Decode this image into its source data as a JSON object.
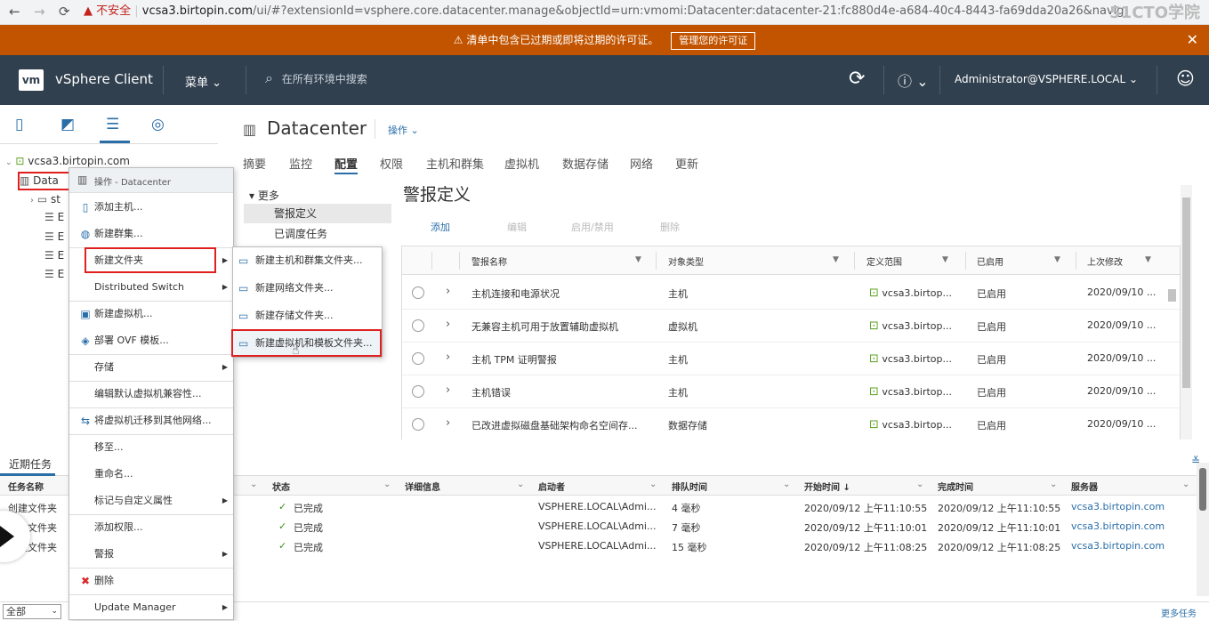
{
  "browser": {
    "back": "←",
    "forward": "→",
    "reload": "⟳",
    "insecure": "▲ 不安全",
    "url_host": "vcsa3.birtopin.com",
    "url_path": "/ui/#?extensionId=vsphere.core.datacenter.manage&objectId=urn:vmomi:Datacenter:datacenter-21:fc880d4e-a684-40c4-8443-fa69dda20a26&navigator=vsph",
    "watermark": "51CTO学院"
  },
  "banner": {
    "message": "⚠ 清单中包含已过期或即将过期的许可证。",
    "button": "管理您的许可证",
    "close": "✕"
  },
  "header": {
    "logo": "vm",
    "title": "vSphere Client",
    "menu": "菜单 ⌄",
    "search_placeholder": "在所有环境中搜索",
    "search_icon": "⌕",
    "refresh": "⟳",
    "help": "ⓘ ⌄",
    "user": "Administrator@VSPHERE.LOCAL ⌄",
    "smiley": "☺"
  },
  "nav": {
    "tree": {
      "root": "vcsa3.birtopin.com",
      "datacenter": "Data",
      "folder": "st",
      "hosts": [
        "E",
        "E",
        "E",
        "E"
      ]
    }
  },
  "main": {
    "title": "Datacenter",
    "actions": "操作 ⌄",
    "tabs": [
      "摘要",
      "监控",
      "配置",
      "权限",
      "主机和群集",
      "虚拟机",
      "数据存储",
      "网络",
      "更新"
    ],
    "sub_more": "▾ 更多",
    "sub_alarm": "警报定义",
    "sub_tasks": "已调度任务",
    "section_title": "警报定义",
    "toolbar": {
      "add": "添加",
      "edit": "编辑",
      "toggle": "启用/禁用",
      "delete": "删除"
    },
    "grid": {
      "columns": [
        "警报名称",
        "对象类型",
        "定义范围",
        "已启用",
        "上次修改"
      ],
      "rows": [
        {
          "name": "主机连接和电源状况",
          "type": "主机",
          "scope": "vcsa3.birtop...",
          "enabled": "已启用",
          "modified": "2020/09/10 ..."
        },
        {
          "name": "无兼容主机可用于放置辅助虚拟机",
          "type": "虚拟机",
          "scope": "vcsa3.birtop...",
          "enabled": "已启用",
          "modified": "2020/09/10 ..."
        },
        {
          "name": "主机 TPM 证明警报",
          "type": "主机",
          "scope": "vcsa3.birtop...",
          "enabled": "已启用",
          "modified": "2020/09/10 ..."
        },
        {
          "name": "主机错误",
          "type": "主机",
          "scope": "vcsa3.birtop...",
          "enabled": "已启用",
          "modified": "2020/09/10 ..."
        },
        {
          "name": "已改进虚拟磁盘基础架构命名空间存...",
          "type": "数据存储",
          "scope": "vcsa3.birtop...",
          "enabled": "已启用",
          "modified": "2020/09/10 ..."
        }
      ]
    }
  },
  "context_menu": {
    "header": "操作 - Datacenter",
    "items": [
      {
        "label": "添加主机...",
        "icon": "add-host-icon",
        "glyph": "▯"
      },
      {
        "label": "新建群集...",
        "icon": "cluster-icon",
        "glyph": "◍"
      },
      {
        "label": "新建文件夹",
        "icon": "",
        "glyph": "",
        "arrow": "▶"
      },
      {
        "label": "Distributed Switch",
        "icon": "",
        "glyph": "",
        "arrow": "▶"
      },
      {
        "label": "新建虚拟机...",
        "icon": "new-vm-icon",
        "glyph": "▣"
      },
      {
        "label": "部署 OVF 模板...",
        "icon": "ovf-icon",
        "glyph": "◈"
      },
      {
        "label": "存储",
        "icon": "",
        "glyph": "",
        "arrow": "▶"
      },
      {
        "label": "编辑默认虚拟机兼容性...",
        "icon": "",
        "glyph": ""
      },
      {
        "label": "将虚拟机迁移到其他网络...",
        "icon": "migrate-icon",
        "glyph": "⇆"
      },
      {
        "label": "移至...",
        "icon": "",
        "glyph": ""
      },
      {
        "label": "重命名...",
        "icon": "",
        "glyph": ""
      },
      {
        "label": "标记与自定义属性",
        "icon": "",
        "glyph": "",
        "arrow": "▶"
      },
      {
        "label": "添加权限...",
        "icon": "",
        "glyph": ""
      },
      {
        "label": "警报",
        "icon": "",
        "glyph": "",
        "arrow": "▶"
      },
      {
        "label": "删除",
        "icon": "delete-icon",
        "glyph": "✖"
      },
      {
        "label": "Update Manager",
        "icon": "",
        "glyph": "",
        "arrow": "▶"
      }
    ]
  },
  "submenu": {
    "items": [
      "新建主机和群集文件夹...",
      "新建网络文件夹...",
      "新建存储文件夹...",
      "新建虚拟机和模板文件夹..."
    ]
  },
  "recent_tasks": {
    "tab": "近期任务",
    "collapse": "≚",
    "columns": [
      "任务名称",
      "状态",
      "详细信息",
      "启动者",
      "排队时间",
      "开始时间 ↓",
      "完成时间",
      "服务器"
    ],
    "rows": [
      {
        "name": "创建文件夹",
        "status": "已完成",
        "initiator": "VSPHERE.LOCAL\\Admi...",
        "queued": "4 毫秒",
        "start": "2020/09/12 上午11:10:55",
        "end": "2020/09/12 上午11:10:55",
        "server": "vcsa3.birtopin.com"
      },
      {
        "name": "建文件夹",
        "status": "已完成",
        "initiator": "VSPHERE.LOCAL\\Admi...",
        "queued": "7 毫秒",
        "start": "2020/09/12 上午11:10:01",
        "end": "2020/09/12 上午11:10:01",
        "server": "vcsa3.birtopin.com"
      },
      {
        "name": "建文件夹",
        "status": "已完成",
        "initiator": "VSPHERE.LOCAL\\Admi...",
        "queued": "15 毫秒",
        "start": "2020/09/12 上午11:08:25",
        "end": "2020/09/12 上午11:08:25",
        "server": "vcsa3.birtopin.com"
      }
    ],
    "filter": "全部",
    "more": "更多任务"
  },
  "colors": {
    "banner": "#c25400",
    "header": "#30404f",
    "accent": "#2a6ea8",
    "highlight": "#e0201f"
  }
}
